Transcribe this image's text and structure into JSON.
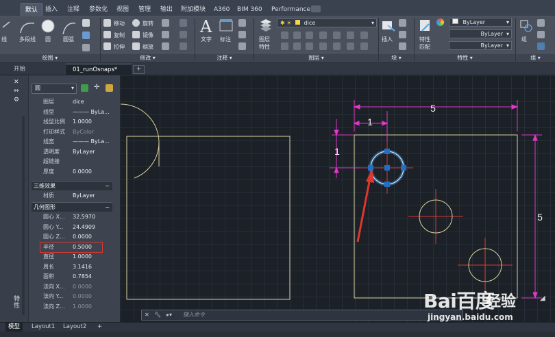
{
  "ribbon_tabs": [
    "默认",
    "插入",
    "注释",
    "参数化",
    "视图",
    "管理",
    "输出",
    "附加模块",
    "A360",
    "BIM 360",
    "Performance"
  ],
  "ribbon": {
    "draw": {
      "polyline": "多段线",
      "circle": "圆",
      "arc": "圆弧",
      "title": "绘图 ▾",
      "line": "线"
    },
    "modify": {
      "move": "移动",
      "rotate": "旋转",
      "copy": "复制",
      "mirror": "镜像",
      "stretch": "拉伸",
      "scale": "缩放",
      "title": "修改 ▾"
    },
    "annotation": {
      "text": "文字",
      "dimension": "标注",
      "title": "注释 ▾"
    },
    "layers": {
      "layer_props": "图层特性",
      "layer_name": "dice",
      "title": "图层 ▾",
      "layer_label": "图层",
      "props_label": "特性"
    },
    "block": {
      "insert": "插入",
      "title": "块 ▾"
    },
    "properties": {
      "match": "特性匹配",
      "color": "ByLayer",
      "linetype": "ByLayer",
      "lineweight": "ByLayer",
      "title": "特性 ▾",
      "match_l1": "特性",
      "match_l2": "匹配"
    },
    "groups": {
      "group": "组",
      "title": "组 ▾"
    }
  },
  "file_tabs": {
    "start": "开始",
    "drawing": "01_runOsnaps*",
    "new": "+"
  },
  "palette": {
    "object_type": "圆",
    "general": [
      {
        "label": "图层",
        "value": "dice"
      },
      {
        "label": "线型",
        "value": "——— ByLa..."
      },
      {
        "label": "线型比例",
        "value": "1.0000"
      },
      {
        "label": "打印样式",
        "value": "ByColor",
        "dim": true
      },
      {
        "label": "线宽",
        "value": "——— ByLa..."
      },
      {
        "label": "透明度",
        "value": "ByLayer"
      },
      {
        "label": "超链接",
        "value": ""
      },
      {
        "label": "厚度",
        "value": "0.0000"
      }
    ],
    "section_3d": "三维效果",
    "material": {
      "label": "材质",
      "value": "ByLayer"
    },
    "section_geometry": "几何图形",
    "geometry": [
      {
        "label": "圆心 X...",
        "value": "32.5970"
      },
      {
        "label": "圆心 Y...",
        "value": "24.4909"
      },
      {
        "label": "圆心 Z...",
        "value": "0.0000"
      },
      {
        "label": "半径",
        "value": "0.5000"
      },
      {
        "label": "直径",
        "value": "1.0000"
      },
      {
        "label": "周长",
        "value": "3.1416"
      },
      {
        "label": "面积",
        "value": "0.7854"
      },
      {
        "label": "法向 X...",
        "value": "0.0000",
        "dim": true
      },
      {
        "label": "法向 Y...",
        "value": "0.0000",
        "dim": true
      },
      {
        "label": "法向 Z...",
        "value": "1.0000",
        "dim": true
      }
    ],
    "side_title": "特性"
  },
  "canvas": {
    "dim_top": "5",
    "dim_small_x": "1",
    "dim_small_y": "1",
    "dim_right": "5"
  },
  "command_line": {
    "placeholder": "键入命令"
  },
  "layout_tabs": [
    "模型",
    "Layout1",
    "Layout2",
    "+"
  ],
  "watermark": {
    "brand": "Bai百度",
    "cn": "经验",
    "url": "jingyan.baidu.com"
  },
  "colors": {
    "accent_dim": "#e038c8",
    "selected_circle": "#3f8fd8",
    "square": "#d9d3a0",
    "red_cross": "#d43a3a",
    "arrow": "#e0362e"
  }
}
